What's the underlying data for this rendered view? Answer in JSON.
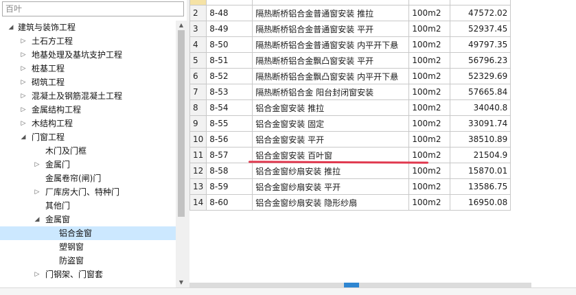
{
  "search": {
    "placeholder": "百叶",
    "value": ""
  },
  "tree": {
    "nodes": [
      {
        "label": "建筑与装饰工程",
        "level": 0,
        "toggle": "expanded"
      },
      {
        "label": "土石方工程",
        "level": 1,
        "toggle": "collapsed"
      },
      {
        "label": "地基处理及基坑支护工程",
        "level": 1,
        "toggle": "collapsed"
      },
      {
        "label": "桩基工程",
        "level": 1,
        "toggle": "collapsed"
      },
      {
        "label": "砌筑工程",
        "level": 1,
        "toggle": "collapsed"
      },
      {
        "label": "混凝土及钢筋混凝土工程",
        "level": 1,
        "toggle": "collapsed"
      },
      {
        "label": "金属结构工程",
        "level": 1,
        "toggle": "collapsed"
      },
      {
        "label": "木结构工程",
        "level": 1,
        "toggle": "collapsed"
      },
      {
        "label": "门窗工程",
        "level": 1,
        "toggle": "expanded"
      },
      {
        "label": "木门及门框",
        "level": 2,
        "toggle": "none"
      },
      {
        "label": "金属门",
        "level": 2,
        "toggle": "collapsed"
      },
      {
        "label": "金属卷帘(闸)门",
        "level": 2,
        "toggle": "none"
      },
      {
        "label": "厂库房大门、特种门",
        "level": 2,
        "toggle": "collapsed"
      },
      {
        "label": "其他门",
        "level": 2,
        "toggle": "none"
      },
      {
        "label": "金属窗",
        "level": 2,
        "toggle": "expanded"
      },
      {
        "label": "铝合金窗",
        "level": 3,
        "toggle": "none",
        "selected": true
      },
      {
        "label": "塑钢窗",
        "level": 3,
        "toggle": "none"
      },
      {
        "label": "防盗窗",
        "level": 3,
        "toggle": "none"
      },
      {
        "label": "门钢架、门窗套",
        "level": 2,
        "toggle": "collapsed"
      }
    ]
  },
  "icons": {
    "expanded": "expanded-triangle-icon",
    "collapsed": "collapsed-triangle-icon",
    "scroll_up": "scroll-up-arrow-icon",
    "scroll_down": "scroll-down-arrow-icon"
  },
  "grid": {
    "partial_top_row": {
      "idx": "1",
      "code": "",
      "name": "",
      "unit": "",
      "price": ""
    },
    "rows": [
      {
        "idx": "2",
        "code": "8-48",
        "name": "隔热断桥铝合金普通窗安装 推拉",
        "unit": "100m2",
        "price": "47572.02"
      },
      {
        "idx": "3",
        "code": "8-49",
        "name": "隔热断桥铝合金普通窗安装 平开",
        "unit": "100m2",
        "price": "52937.45"
      },
      {
        "idx": "4",
        "code": "8-50",
        "name": "隔热断桥铝合金普通窗安装 内平开下悬",
        "unit": "100m2",
        "price": "49797.35"
      },
      {
        "idx": "5",
        "code": "8-51",
        "name": "隔热断桥铝合金飘凸窗安装 平开",
        "unit": "100m2",
        "price": "56796.23"
      },
      {
        "idx": "6",
        "code": "8-52",
        "name": "隔热断桥铝合金飘凸窗安装 内平开下悬",
        "unit": "100m2",
        "price": "52329.69"
      },
      {
        "idx": "7",
        "code": "8-53",
        "name": "隔热断桥铝合金 阳台封闭窗安装",
        "unit": "100m2",
        "price": "57665.84"
      },
      {
        "idx": "8",
        "code": "8-54",
        "name": "铝合金窗安装 推拉",
        "unit": "100m2",
        "price": "34040.8"
      },
      {
        "idx": "9",
        "code": "8-55",
        "name": "铝合金窗安装 固定",
        "unit": "100m2",
        "price": "33091.74"
      },
      {
        "idx": "10",
        "code": "8-56",
        "name": "铝合金窗安装 平开",
        "unit": "100m2",
        "price": "38510.89"
      },
      {
        "idx": "11",
        "code": "8-57",
        "name": "铝合金窗安装 百叶窗",
        "unit": "100m2",
        "price": "21504.9"
      },
      {
        "idx": "12",
        "code": "8-58",
        "name": "铝合金窗纱扇安装 推拉",
        "unit": "100m2",
        "price": "15870.01"
      },
      {
        "idx": "13",
        "code": "8-59",
        "name": "铝合金窗纱扇安装 平开",
        "unit": "100m2",
        "price": "13586.75"
      },
      {
        "idx": "14",
        "code": "8-60",
        "name": "铝合金窗纱扇安装 隐形纱扇",
        "unit": "100m2",
        "price": "16950.08"
      }
    ]
  },
  "colors": {
    "selected_bg": "#cce8ff",
    "annotation_underline": "#e0384e",
    "scroll_grip": "#2f86d1"
  }
}
